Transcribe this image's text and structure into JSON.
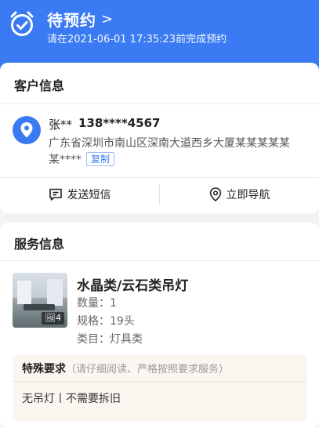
{
  "header": {
    "title": "待预约",
    "chevron": ">",
    "subtitle": "请在2021-06-01 17:35:23前完成预约",
    "icon": "alarm-clock-check-icon"
  },
  "customer": {
    "section_title": "客户信息",
    "name": "张**",
    "phone": "138****4567",
    "address": "广东省深圳市南山区深南大道西乡大厦某某某某某某****",
    "copy_label": "复制",
    "actions": {
      "sms_label": "发送短信",
      "nav_label": "立即导航"
    }
  },
  "service": {
    "section_title": "服务信息",
    "product": {
      "name": "水晶类/云石类吊灯",
      "quantity": "数量：1",
      "spec": "规格：19头",
      "category": "类目：灯具类",
      "image_count": "4"
    },
    "special": {
      "label": "特殊要求",
      "hint": "（请仔细阅读、严格按照要求服务）",
      "content": "无吊灯丨不需要拆旧"
    }
  },
  "colors": {
    "primary": "#3a7bf3",
    "special_bg": "#fcf6f1"
  }
}
